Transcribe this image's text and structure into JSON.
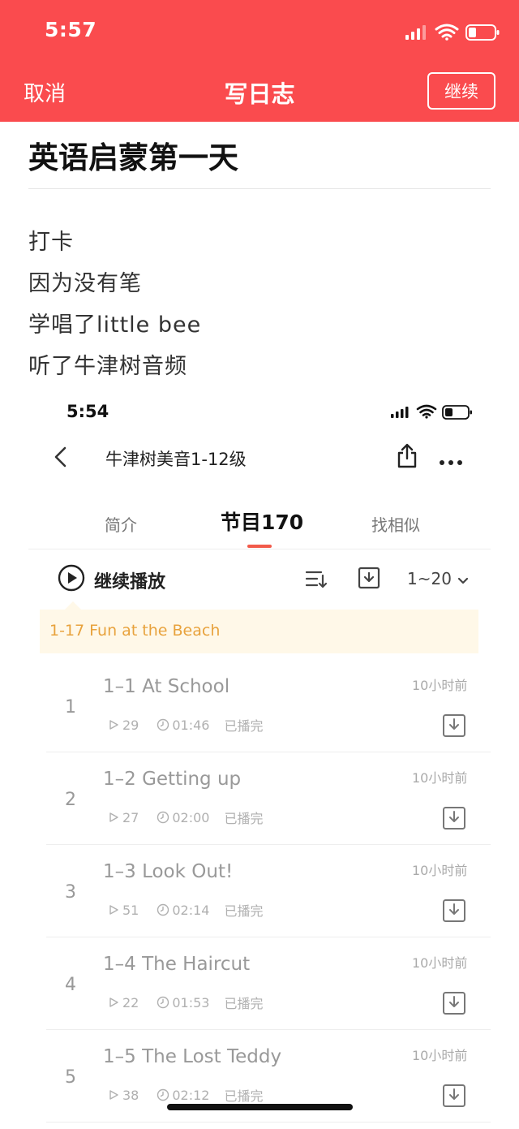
{
  "status_bar": {
    "time": "5:57"
  },
  "nav": {
    "cancel": "取消",
    "title": "写日志",
    "continue": "继续"
  },
  "diary": {
    "title": "英语启蒙第一天",
    "lines": [
      "打卡",
      "因为没有笔",
      "学唱了little bee",
      "听了牛津树音频"
    ]
  },
  "embedded": {
    "time": "5:54",
    "title": "牛津树美音1-12级",
    "tabs": {
      "intro": "简介",
      "episodes": "节目170",
      "similar": "找相似"
    },
    "continue_play": "继续播放",
    "range": "1~20",
    "last_played": "1-17 Fun at the Beach",
    "episodes": [
      {
        "num": "1",
        "title": "1–1 At School",
        "plays": "29",
        "duration": "01:46",
        "status": "已播完",
        "ago": "10小时前"
      },
      {
        "num": "2",
        "title": "1–2 Getting up",
        "plays": "27",
        "duration": "02:00",
        "status": "已播完",
        "ago": "10小时前"
      },
      {
        "num": "3",
        "title": "1–3 Look Out!",
        "plays": "51",
        "duration": "02:14",
        "status": "已播完",
        "ago": "10小时前"
      },
      {
        "num": "4",
        "title": "1–4 The Haircut",
        "plays": "22",
        "duration": "01:53",
        "status": "已播完",
        "ago": "10小时前"
      },
      {
        "num": "5",
        "title": "1–5 The Lost Teddy",
        "plays": "38",
        "duration": "02:12",
        "status": "已播完",
        "ago": "10小时前"
      }
    ]
  },
  "colors": {
    "header": "#fa4b4e",
    "accent": "#f25a4a",
    "banner_text": "#e8a23c",
    "banner_bg": "#fff8e8"
  },
  "icons": [
    "signal-icon",
    "wifi-icon",
    "battery-icon",
    "back-arrow-icon",
    "share-icon",
    "more-icon",
    "play-circle-icon",
    "sort-icon",
    "download-icon",
    "chevron-down-icon",
    "play-count-icon",
    "clock-icon"
  ]
}
